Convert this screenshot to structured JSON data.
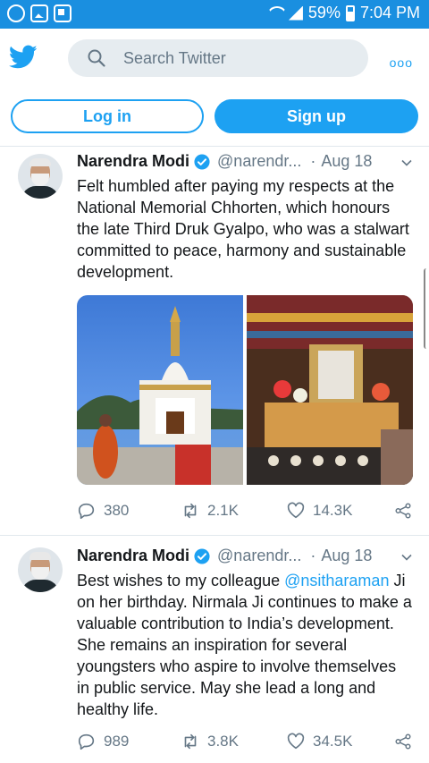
{
  "status_bar": {
    "battery": "59%",
    "time": "7:04 PM"
  },
  "header": {
    "search_placeholder": "Search Twitter",
    "more_label": "ooo"
  },
  "auth": {
    "login_label": "Log in",
    "signup_label": "Sign up"
  },
  "tweets": [
    {
      "author": "Narendra Modi",
      "handle": "@narendr...",
      "separator": "·",
      "date": "Aug 18",
      "text": "Felt humbled after paying my respects at the National Memorial Chhorten, which honours the late Third Druk Gyalpo, who was a stalwart committed to peace, harmony and sustainable development.",
      "replies": "380",
      "retweets": "2.1K",
      "likes": "14.3K"
    },
    {
      "author": "Narendra Modi",
      "handle": "@narendr...",
      "separator": "·",
      "date": "Aug 18",
      "text_before": "Best wishes to my colleague ",
      "mention": "@nsitharaman",
      "text_after": " Ji on her birthday. Nirmala Ji continues to make a valuable contribution to India’s development. She remains an inspiration for several youngsters who aspire to involve themselves in public service. May she lead a long and healthy life.",
      "replies": "989",
      "retweets": "3.8K",
      "likes": "34.5K"
    }
  ],
  "colors": {
    "accent": "#1da1f2",
    "status_bar": "#1a8fe0",
    "secondary_text": "#657786"
  }
}
